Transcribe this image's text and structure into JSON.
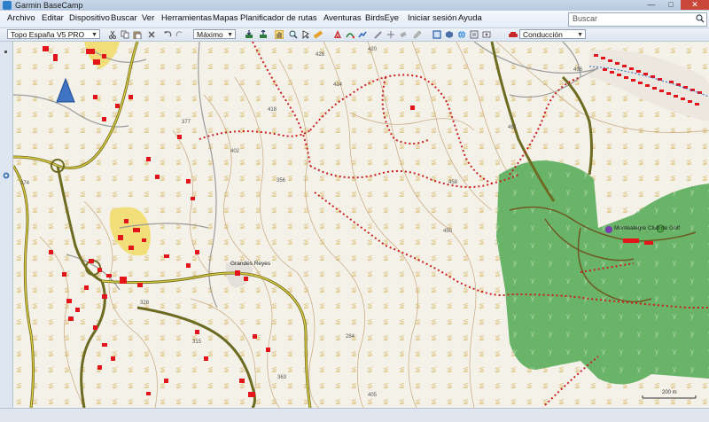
{
  "window": {
    "title": "Garmin BaseCamp"
  },
  "menu": [
    "Archivo",
    "Editar",
    "Dispositivo",
    "Buscar",
    "Ver",
    "Herramientas",
    "Mapas",
    "Planificador de rutas",
    "Aventuras",
    "BirdsEye",
    "Iniciar sesión",
    "Ayuda"
  ],
  "search": {
    "placeholder": "Buscar"
  },
  "toolbar": {
    "map_product": "Topo España V5 PRO",
    "detail_level": "Máximo",
    "profile": "Conducción"
  },
  "map": {
    "place_label": "Montealegre Club de Golf",
    "village_label": "Grandes Reyes",
    "scale": "200 m",
    "elevations": [
      "402",
      "356",
      "418",
      "414",
      "461",
      "458",
      "450",
      "420",
      "428",
      "284",
      "315",
      "363",
      "405",
      "274",
      "328",
      "377",
      "436"
    ]
  },
  "colors": {
    "map_bg": "#f3f1e8",
    "forest": "#6ab469",
    "trail": "#cc1f1f",
    "road": "#cfc23a",
    "building": "#e3141a",
    "contour": "#c9a77d"
  }
}
